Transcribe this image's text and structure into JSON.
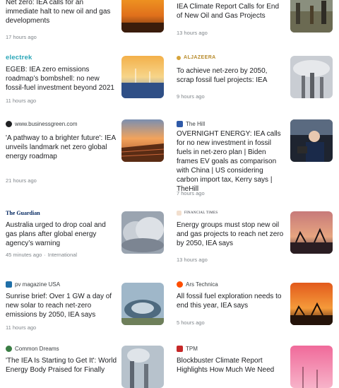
{
  "articles": [
    {
      "source": "",
      "headline": "Net zero: IEA calls for an immediate halt to new oil and gas developments",
      "time": "17 hours ago",
      "tag": "",
      "thumbnail_icon": "sunset-sky-image"
    },
    {
      "source": "",
      "headline": "IEA Climate Report Calls for End of New Oil and Gas Projects",
      "time": "13 hours ago",
      "tag": "",
      "thumbnail_icon": "oil-field-workers-image"
    },
    {
      "source": "electrek",
      "headline": "EGEB: IEA zero emissions roadmap’s bombshell: no new fossil-fuel investment beyond 2021",
      "time": "11 hours ago",
      "tag": "",
      "thumbnail_icon": "solar-wind-farm-image"
    },
    {
      "source": "ALJAZEERA",
      "headline": "To achieve net-zero by 2050, scrap fossil fuel projects: IEA",
      "time": "9 hours ago",
      "tag": "",
      "thumbnail_icon": "smokestacks-image"
    },
    {
      "source": "www.businessgreen.com",
      "headline": "'A pathway to a brighter future': IEA unveils landmark net zero global energy roadmap",
      "time": "21 hours ago",
      "tag": "",
      "thumbnail_icon": "solar-panels-sunset-image"
    },
    {
      "source": "The Hill",
      "headline": "OVERNIGHT ENERGY: IEA calls for no new investment in fossil fuels in net-zero plan | Biden frames EV goals as comparison with China | US considering carbon import tax, Kerry says | TheHill",
      "time": "7 hours ago",
      "tag": "",
      "thumbnail_icon": "biden-in-vehicle-image"
    },
    {
      "source": "The Guardian",
      "headline": "Australia urged to drop coal and gas plans after global energy agency’s warning",
      "time": "45 minutes ago",
      "tag": "International",
      "thumbnail_icon": "steam-clouds-image"
    },
    {
      "source": "FINANCIAL TIMES",
      "headline": "Energy groups must stop new oil and gas projects to reach net zero by 2050, IEA says",
      "time": "13 hours ago",
      "tag": "",
      "thumbnail_icon": "oil-pumpjacks-image"
    },
    {
      "source": "pv magazine USA",
      "headline": "Sunrise brief: Over 1 GW a day of new solar to reach net-zero emissions by 2050, IEA says",
      "time": "11 hours ago",
      "tag": "",
      "thumbnail_icon": "solar-dome-aerial-image"
    },
    {
      "source": "Ars Technica",
      "headline": "All fossil fuel exploration needs to end this year, IEA says",
      "time": "5 hours ago",
      "tag": "",
      "thumbnail_icon": "orange-sky-pumpjacks-image"
    },
    {
      "source": "Common Dreams",
      "headline": "'The IEA Is Starting to Get It': World Energy Body Praised for Finally",
      "time": "",
      "tag": "",
      "thumbnail_icon": "power-plant-image"
    },
    {
      "source": "TPM",
      "headline": "Blockbuster Climate Report Highlights How Much We Need",
      "time": "",
      "tag": "",
      "thumbnail_icon": "pink-wind-turbines-image"
    }
  ]
}
